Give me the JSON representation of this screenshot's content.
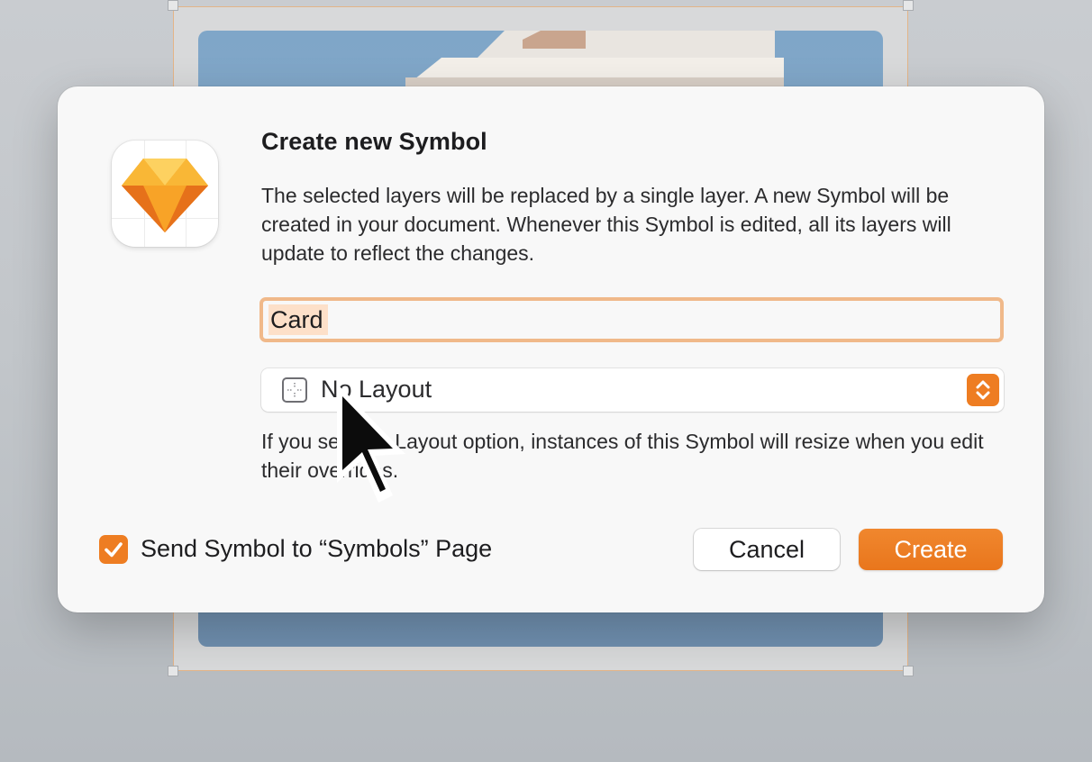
{
  "dialog": {
    "title": "Create new Symbol",
    "description": "The selected layers will be replaced by a single layer. A new Symbol will be created in your document. Whenever this Symbol is edited, all its layers will update to reflect the changes.",
    "app_icon": "sketch-diamond-icon",
    "name_input": {
      "value": "Card",
      "selected": true
    },
    "layout_select": {
      "icon": "layout-grid-icon",
      "value": "No Layout",
      "stepper_icon": "chevron-up-down-icon"
    },
    "layout_hint": "If you select a Layout option, instances of this Symbol will resize when you edit their overrides.",
    "send_checkbox": {
      "checked": true,
      "label": "Send Symbol to “Symbols” Page"
    },
    "buttons": {
      "cancel": "Cancel",
      "create": "Create"
    }
  },
  "colors": {
    "accent": "#EE7D22",
    "focus_ring": "#F0B98A",
    "selection": "#FDE0C9",
    "dialog_bg": "#F8F8F8"
  },
  "cursor": "arrow-pointer-icon"
}
